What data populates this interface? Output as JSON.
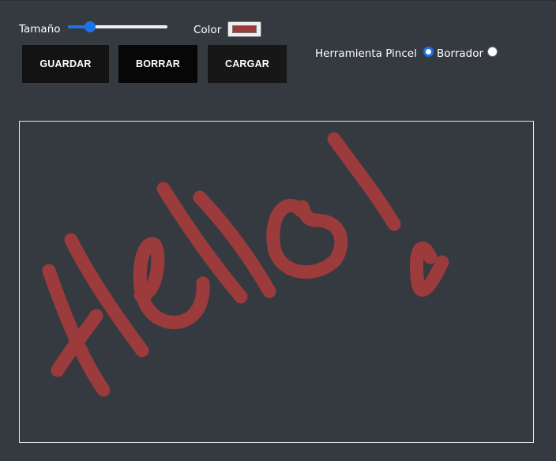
{
  "toolbar": {
    "size_label": "Tamaño",
    "size_value_percent": 20,
    "color_label": "Color",
    "color_value": "#9b3b3b",
    "buttons": {
      "save": "GUARDAR",
      "clear": "BORRAR",
      "load": "CARGAR"
    },
    "tool_label": "Herramienta Pincel",
    "eraser_label": "Borrador",
    "selected_tool": "Pincel"
  },
  "colors": {
    "background": "#353a41",
    "accent": "#1a73e8",
    "stroke": "#9b3b3b"
  },
  "canvas": {
    "drawn_text": "Hello!"
  }
}
